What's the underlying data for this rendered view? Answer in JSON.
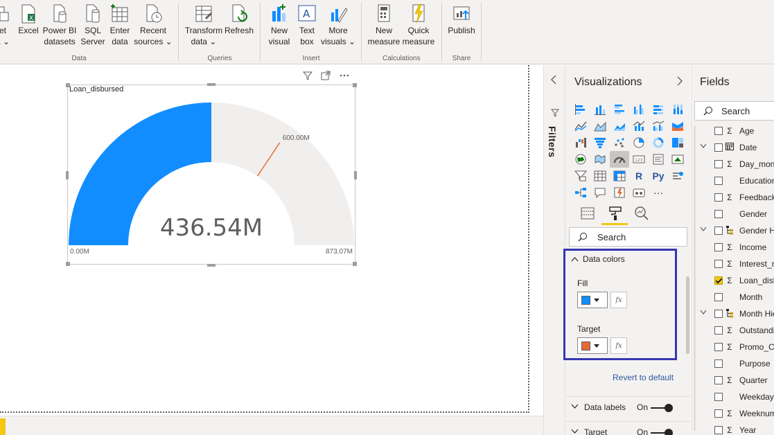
{
  "ribbon": {
    "data_group": {
      "label": "Data",
      "buttons": [
        {
          "line1": "et",
          "line2": "a ⌄"
        },
        {
          "line1": "Excel",
          "line2": ""
        },
        {
          "line1": "Power BI",
          "line2": "datasets"
        },
        {
          "line1": "SQL",
          "line2": "Server"
        },
        {
          "line1": "Enter",
          "line2": "data"
        },
        {
          "line1": "Recent",
          "line2": "sources ⌄"
        }
      ]
    },
    "queries_group": {
      "label": "Queries",
      "buttons": [
        {
          "line1": "Transform",
          "line2": "data ⌄"
        },
        {
          "line1": "Refresh",
          "line2": ""
        }
      ]
    },
    "insert_group": {
      "label": "Insert",
      "buttons": [
        {
          "line1": "New",
          "line2": "visual"
        },
        {
          "line1": "Text",
          "line2": "box"
        },
        {
          "line1": "More",
          "line2": "visuals ⌄"
        }
      ]
    },
    "calculations_group": {
      "label": "Calculations",
      "buttons": [
        {
          "line1": "New",
          "line2": "measure"
        },
        {
          "line1": "Quick",
          "line2": "measure"
        }
      ]
    },
    "share_group": {
      "label": "Share",
      "buttons": [
        {
          "line1": "Publish",
          "line2": ""
        }
      ]
    }
  },
  "visual": {
    "title": "Loan_disbursed",
    "value_label": "436.54M",
    "min_label": "0.00M",
    "max_label": "873.07M",
    "target_label": "600.00M"
  },
  "chart_data": {
    "type": "gauge",
    "title": "Loan_disbursed",
    "min": 0,
    "max": 873.07,
    "value": 436.54,
    "target": 600.0,
    "unit": "M",
    "colors": {
      "fill": "#118dff",
      "target": "#e66c37",
      "track": "#f0efee"
    }
  },
  "filters": {
    "label": "Filters"
  },
  "viz_pane": {
    "title": "Visualizations",
    "search_placeholder": "Search",
    "data_colors": {
      "header": "Data colors",
      "fill_label": "Fill",
      "fill_color": "#118dff",
      "target_label": "Target",
      "target_color": "#e66c37",
      "fx": "fx"
    },
    "revert": "Revert to default",
    "data_labels": {
      "label": "Data labels",
      "state": "On"
    },
    "target_section": {
      "label": "Target",
      "state": "On"
    },
    "py_label": "Py",
    "r_label": "R",
    "more_label": "···"
  },
  "fields_pane": {
    "title": "Fields",
    "search_placeholder": "Search",
    "fields": [
      {
        "name": "Age",
        "icon": "sigma",
        "checked": false,
        "expander": false
      },
      {
        "name": "Date",
        "icon": "calendar",
        "checked": false,
        "expander": true
      },
      {
        "name": "Day_month",
        "icon": "sigma",
        "checked": false,
        "expander": false
      },
      {
        "name": "Education",
        "icon": "none",
        "checked": false,
        "expander": false
      },
      {
        "name": "Feedback",
        "icon": "sigma",
        "checked": false,
        "expander": false
      },
      {
        "name": "Gender",
        "icon": "none",
        "checked": false,
        "expander": false
      },
      {
        "name": "Gender Hierarchy",
        "icon": "hierarchy",
        "checked": false,
        "expander": true
      },
      {
        "name": "Income",
        "icon": "sigma",
        "checked": false,
        "expander": false
      },
      {
        "name": "Interest_rate",
        "icon": "sigma",
        "checked": false,
        "expander": false
      },
      {
        "name": "Loan_disbursed",
        "icon": "sigma",
        "checked": true,
        "expander": false
      },
      {
        "name": "Month",
        "icon": "none",
        "checked": false,
        "expander": false
      },
      {
        "name": "Month Hierarchy",
        "icon": "hierarchy",
        "checked": false,
        "expander": true
      },
      {
        "name": "Outstanding",
        "icon": "sigma",
        "checked": false,
        "expander": false
      },
      {
        "name": "Promo_Campaign",
        "icon": "sigma",
        "checked": false,
        "expander": false
      },
      {
        "name": "Purpose",
        "icon": "none",
        "checked": false,
        "expander": false
      },
      {
        "name": "Quarter",
        "icon": "sigma",
        "checked": false,
        "expander": false
      },
      {
        "name": "Weekday",
        "icon": "none",
        "checked": false,
        "expander": false
      },
      {
        "name": "Weeknum",
        "icon": "sigma",
        "checked": false,
        "expander": false
      },
      {
        "name": "Year",
        "icon": "sigma",
        "checked": false,
        "expander": false
      }
    ]
  }
}
